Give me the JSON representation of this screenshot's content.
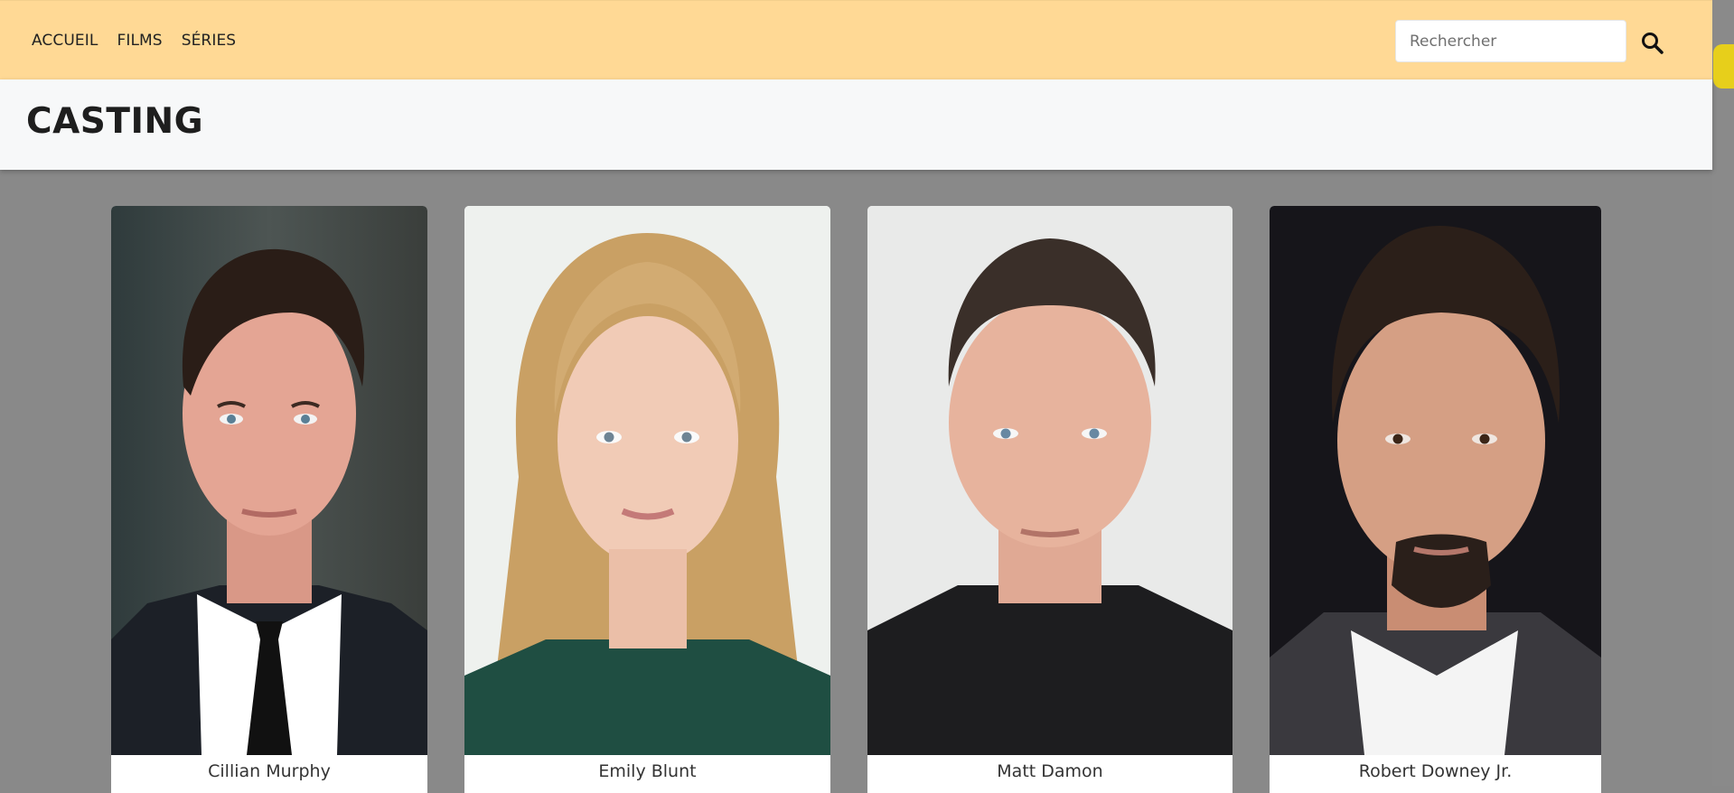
{
  "nav": {
    "links": [
      "ACCUEIL",
      "FILMS",
      "SÉRIES"
    ],
    "search_placeholder": "Rechercher",
    "search_icon": "search-icon"
  },
  "page": {
    "title": "CASTING"
  },
  "cast": [
    {
      "name": "Cillian Murphy"
    },
    {
      "name": "Emily Blunt"
    },
    {
      "name": "Matt Damon"
    },
    {
      "name": "Robert Downey Jr."
    }
  ],
  "colors": {
    "navbar": "#ffd995",
    "background": "#898989",
    "header": "#f7f8f9",
    "scroll_thumb": "#e7cf1b"
  }
}
